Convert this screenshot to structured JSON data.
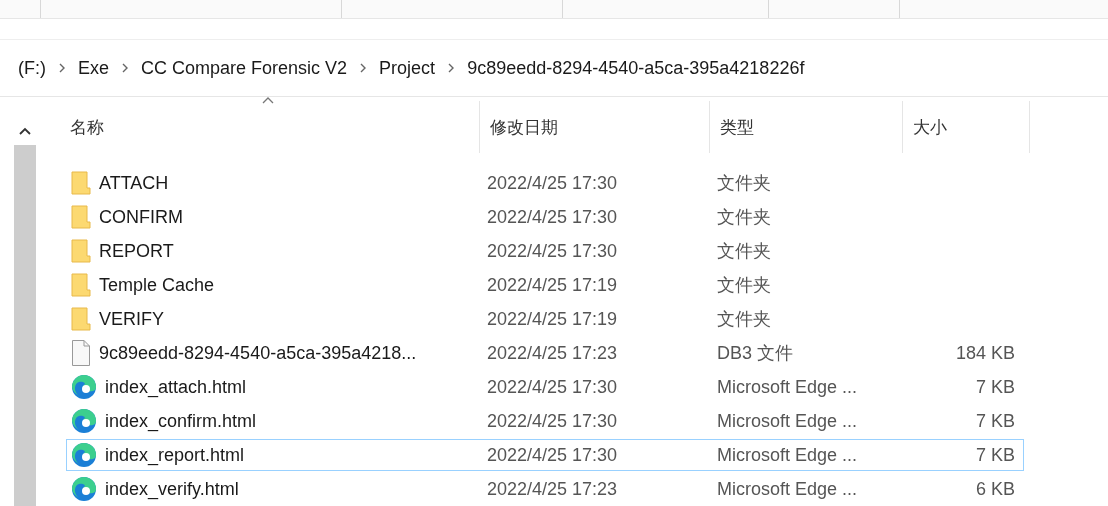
{
  "breadcrumb": [
    "(F:)",
    "Exe",
    "CC Compare Forensic V2",
    "Project",
    "9c89eedd-8294-4540-a5ca-395a4218226f"
  ],
  "columns": [
    "名称",
    "修改日期",
    "类型",
    "大小"
  ],
  "files": [
    {
      "kind": "folder",
      "name": "ATTACH",
      "date": "2022/4/25 17:30",
      "type": "文件夹",
      "selected": false
    },
    {
      "kind": "folder",
      "name": "CONFIRM",
      "date": "2022/4/25 17:30",
      "type": "文件夹",
      "selected": false
    },
    {
      "kind": "folder",
      "name": "REPORT",
      "date": "2022/4/25 17:30",
      "type": "文件夹",
      "selected": false
    },
    {
      "kind": "folder",
      "name": "Temple Cache",
      "date": "2022/4/25 17:19",
      "type": "文件夹",
      "selected": false
    },
    {
      "kind": "folder",
      "name": "VERIFY",
      "date": "2022/4/25 17:19",
      "type": "文件夹",
      "selected": false
    },
    {
      "kind": "file",
      "name": "9c89eedd-8294-4540-a5ca-395a4218...",
      "date": "2022/4/25 17:23",
      "type": "DB3 文件",
      "size": "184 KB",
      "selected": false
    },
    {
      "kind": "edge",
      "name": "index_attach.html",
      "date": "2022/4/25 17:30",
      "type": "Microsoft Edge ...",
      "size": "7 KB",
      "selected": false
    },
    {
      "kind": "edge",
      "name": "index_confirm.html",
      "date": "2022/4/25 17:30",
      "type": "Microsoft Edge ...",
      "size": "7 KB",
      "selected": false
    },
    {
      "kind": "edge",
      "name": "index_report.html",
      "date": "2022/4/25 17:30",
      "type": "Microsoft Edge ...",
      "size": "7 KB",
      "selected": true
    },
    {
      "kind": "edge",
      "name": "index_verify.html",
      "date": "2022/4/25 17:23",
      "type": "Microsoft Edge ...",
      "size": "6 KB",
      "selected": false
    }
  ]
}
